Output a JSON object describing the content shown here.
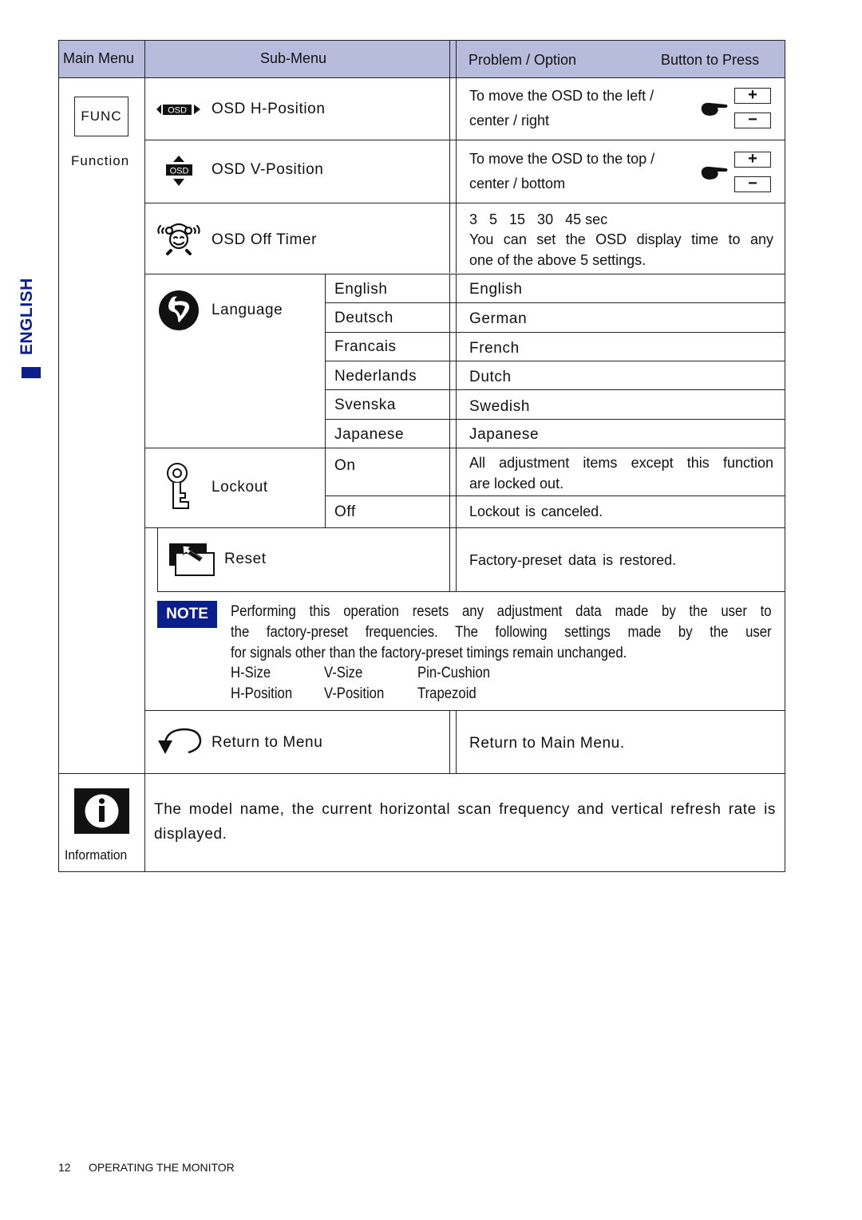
{
  "side_tab": {
    "label": "ENGLISH",
    "color": "#0a1e8c"
  },
  "header": {
    "main_menu": "Main Menu",
    "sub_menu": "Sub-Menu",
    "problem_option": "Problem / Option",
    "button_to_press": "Button to Press",
    "background_color": "#b8bcdc"
  },
  "function_group": {
    "icon_label": "FUNC",
    "caption": "Function"
  },
  "rows": {
    "h_position": {
      "icon": "osd-h-position-icon",
      "icon_text": "OSD",
      "label": "OSD H-Position",
      "desc_line1": "To move the OSD to the left /",
      "desc_line2": "center / right",
      "buttons": [
        "+",
        "−"
      ]
    },
    "v_position": {
      "icon": "osd-v-position-icon",
      "icon_text": "OSD",
      "label": "OSD V-Position",
      "desc_line1": "To move the OSD to the top /",
      "desc_line2": "center / bottom",
      "buttons": [
        "+",
        "−"
      ]
    },
    "off_timer": {
      "icon": "alarm-clock-icon",
      "label": "OSD Off Timer",
      "values_line": "3   5   15   30   45 sec",
      "desc_line1": "You can set the OSD display time to any",
      "desc_line2": "one of the above 5 settings."
    },
    "language": {
      "icon": "globe-icon",
      "label": "Language",
      "options": [
        {
          "option": "English",
          "result": "English"
        },
        {
          "option": "Deutsch",
          "result": "German"
        },
        {
          "option": "Francais",
          "result": "French"
        },
        {
          "option": "Nederlands",
          "result": "Dutch"
        },
        {
          "option": "Svenska",
          "result": "Swedish"
        },
        {
          "option": "Japanese",
          "result": "Japanese"
        }
      ]
    },
    "lockout": {
      "icon": "key-icon",
      "label": "Lockout",
      "options": [
        {
          "option": "On",
          "result_line1": "All adjustment items except this function",
          "result_line2": "are locked out."
        },
        {
          "option": "Off",
          "result_line1": "Lockout is canceled.",
          "result_line2": ""
        }
      ]
    },
    "reset": {
      "icon": "reset-icon",
      "label": "Reset",
      "desc": "Factory-preset data is restored."
    },
    "note": {
      "badge": "NOTE",
      "badge_color": "#0a1e8c",
      "line1": "Performing this operation resets any adjustment data made by the user to",
      "line2": "the factory-preset frequencies. The following settings made by the user",
      "line3": "for signals other than the factory-preset timings remain unchanged.",
      "settings": [
        [
          "H-Size",
          "V-Size",
          "Pin-Cushion"
        ],
        [
          "H-Position",
          "V-Position",
          "Trapezoid"
        ]
      ]
    },
    "return_menu": {
      "icon": "return-arrow-icon",
      "label": "Return to Menu",
      "desc": "Return to Main Menu."
    }
  },
  "information": {
    "icon": "info-icon",
    "caption": "Information",
    "desc_line1": "The model name, the current horizontal scan frequency and vertical refresh rate is",
    "desc_line2": "displayed."
  },
  "footer": {
    "page_number": "12",
    "section": "OPERATING THE MONITOR"
  }
}
